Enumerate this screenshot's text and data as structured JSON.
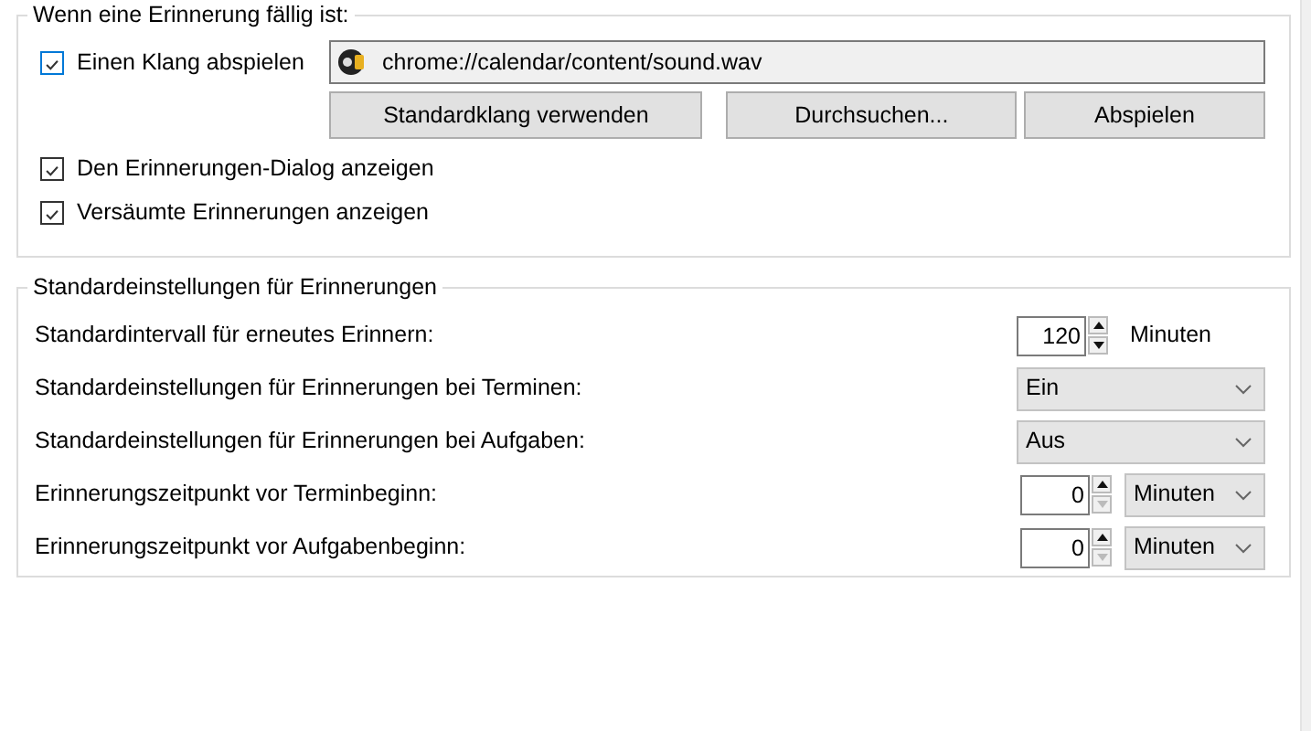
{
  "alert_group": {
    "legend": "Wenn eine Erinnerung fällig ist:",
    "play_sound": {
      "label": "Einen Klang abspielen",
      "checked": true
    },
    "sound_path": {
      "value": "chrome://calendar/content/sound.wav"
    },
    "buttons": [
      "Standardklang verwenden",
      "Durchsuchen...",
      "Abspielen"
    ],
    "options": [
      {
        "label": "Den Erinnerungen-Dialog anzeigen",
        "checked": true
      },
      {
        "label": "Versäumte Erinnerungen anzeigen",
        "checked": true
      }
    ]
  },
  "defaults_group": {
    "legend": "Standardeinstellungen für Erinnerungen",
    "rows": [
      {
        "kind": "spinner",
        "label": "Standardintervall für erneutes Erinnern:",
        "value": "120",
        "decrement_disabled": false,
        "unit": "Minuten"
      },
      {
        "kind": "select",
        "label": "Standardeinstellungen für Erinnerungen bei Terminen:",
        "value": "Ein"
      },
      {
        "kind": "select",
        "label": "Standardeinstellungen für Erinnerungen bei Aufgaben:",
        "value": "Aus"
      },
      {
        "kind": "spinner_select",
        "label": "Erinnerungszeitpunkt vor Terminbeginn:",
        "value": "0",
        "decrement_disabled": true,
        "unit": "Minuten"
      },
      {
        "kind": "spinner_select",
        "label": "Erinnerungszeitpunkt vor Aufgabenbeginn:",
        "value": "0",
        "decrement_disabled": true,
        "unit": "Minuten"
      }
    ]
  }
}
